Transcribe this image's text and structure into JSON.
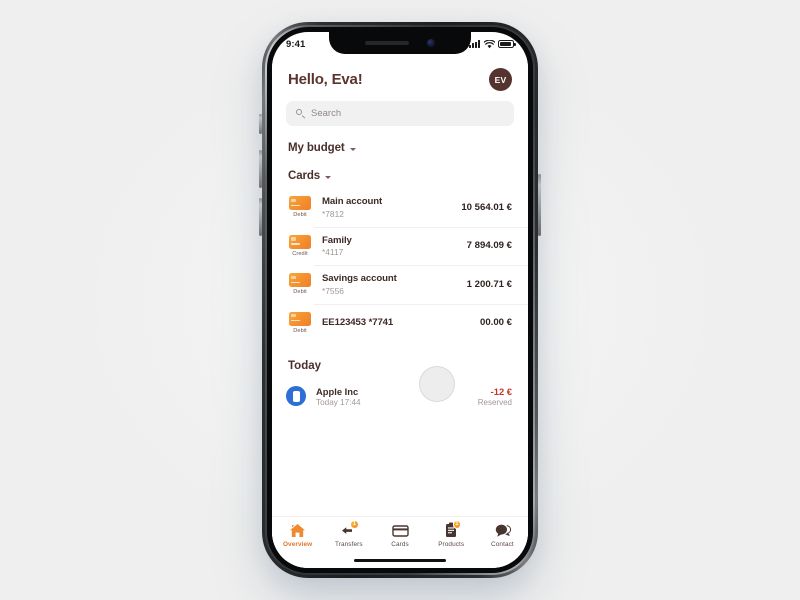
{
  "status_bar": {
    "time": "9:41",
    "signal_icon": "signal-bars-icon",
    "wifi_icon": "wifi-icon",
    "battery_icon": "battery-icon"
  },
  "header": {
    "greeting": "Hello, Eva!",
    "avatar_initials": "EV"
  },
  "search": {
    "placeholder": "Search",
    "value": "",
    "icon": "search-icon"
  },
  "sections": {
    "budget": {
      "title": "My budget",
      "caret": "chevron-down-icon"
    },
    "cards": {
      "title": "Cards",
      "caret": "chevron-down-icon"
    },
    "today": {
      "title": "Today"
    }
  },
  "cards": [
    {
      "type": "Debit",
      "name": "Main account",
      "number": "*7812",
      "amount": "10 564.01 €"
    },
    {
      "type": "Credit",
      "name": "Family",
      "number": "*4117",
      "amount": "7 894.09 €"
    },
    {
      "type": "Debit",
      "name": "Savings account",
      "number": "*7556",
      "amount": "1 200.71 €"
    },
    {
      "type": "Debit",
      "name": "EE123453 *7741",
      "number": "",
      "amount": "00.00 €"
    }
  ],
  "transactions": [
    {
      "merchant": "Apple Inc",
      "time": "Today 17:44",
      "amount": "-12 €",
      "status": "Reserved",
      "icon": "apple-store-icon"
    }
  ],
  "tabs": [
    {
      "label": "Overview",
      "icon": "home-icon",
      "active": true,
      "badge": ""
    },
    {
      "label": "Transfers",
      "icon": "transfer-icon",
      "active": false,
      "badge": "1"
    },
    {
      "label": "Cards",
      "icon": "card-icon",
      "active": false,
      "badge": ""
    },
    {
      "label": "Products",
      "icon": "clipboard-icon",
      "active": false,
      "badge": "1"
    },
    {
      "label": "Contact",
      "icon": "chat-icon",
      "active": false,
      "badge": ""
    }
  ],
  "colors": {
    "accent": "#e2742a",
    "brand_dark": "#4a2f2b",
    "negative": "#c0392b",
    "card_orange": "#f59331"
  }
}
